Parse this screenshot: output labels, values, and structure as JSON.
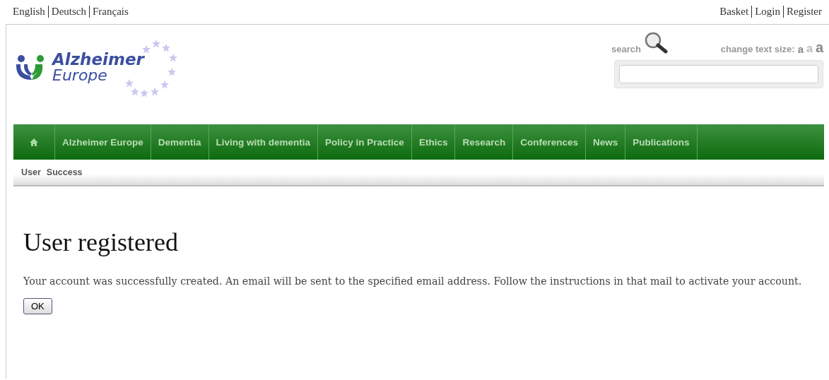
{
  "languages": [
    "English",
    "Deutsch",
    "Français"
  ],
  "account_links": [
    "Basket",
    "Login",
    "Register"
  ],
  "logo": {
    "line_1": "Alzheimer",
    "line_2": "Europe"
  },
  "search": {
    "label": "search"
  },
  "text_size": {
    "label": "change text size:",
    "options": [
      "a",
      "a",
      "a"
    ]
  },
  "nav": [
    "Alzheimer Europe",
    "Dementia",
    "Living with dementia",
    "Policy in Practice",
    "Ethics",
    "Research",
    "Conferences",
    "News",
    "Publications"
  ],
  "breadcrumb": [
    "User",
    "Success"
  ],
  "heading": "User registered",
  "message": "Your account was successfully created. An email will be sent to the specified email address. Follow the instructions in that mail to activate your account.",
  "buttons": [
    "OK"
  ]
}
